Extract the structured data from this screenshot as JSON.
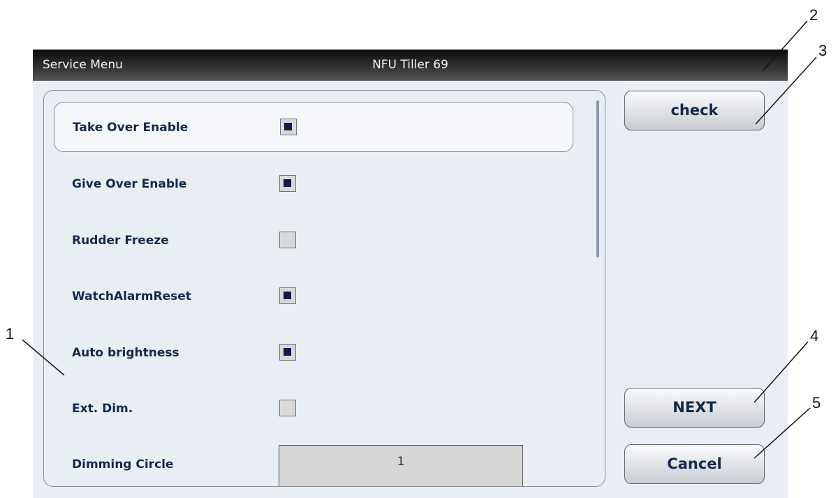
{
  "titlebar": {
    "left": "Service Menu",
    "center": "NFU Tiller 69"
  },
  "settings": [
    {
      "label": "Take Over Enable",
      "type": "checkbox",
      "checked": true,
      "selected": true
    },
    {
      "label": "Give Over Enable",
      "type": "checkbox",
      "checked": true
    },
    {
      "label": "Rudder Freeze",
      "type": "checkbox",
      "checked": false
    },
    {
      "label": "WatchAlarmReset",
      "type": "checkbox",
      "checked": true
    },
    {
      "label": "Auto brightness",
      "type": "checkbox",
      "checked": true
    },
    {
      "label": "Ext. Dim.",
      "type": "checkbox",
      "checked": false
    },
    {
      "label": "Dimming Circle",
      "type": "value",
      "value": "1"
    }
  ],
  "buttons": {
    "check": "check",
    "next": "NEXT",
    "cancel": "Cancel"
  },
  "callouts": [
    "1",
    "2",
    "3",
    "4",
    "5"
  ],
  "colors": {
    "label_text": "#13294b",
    "checkbox_fill": "#0e1b48",
    "titlebar": "#1a1a1a",
    "screen_bg": "#e9edf4"
  }
}
